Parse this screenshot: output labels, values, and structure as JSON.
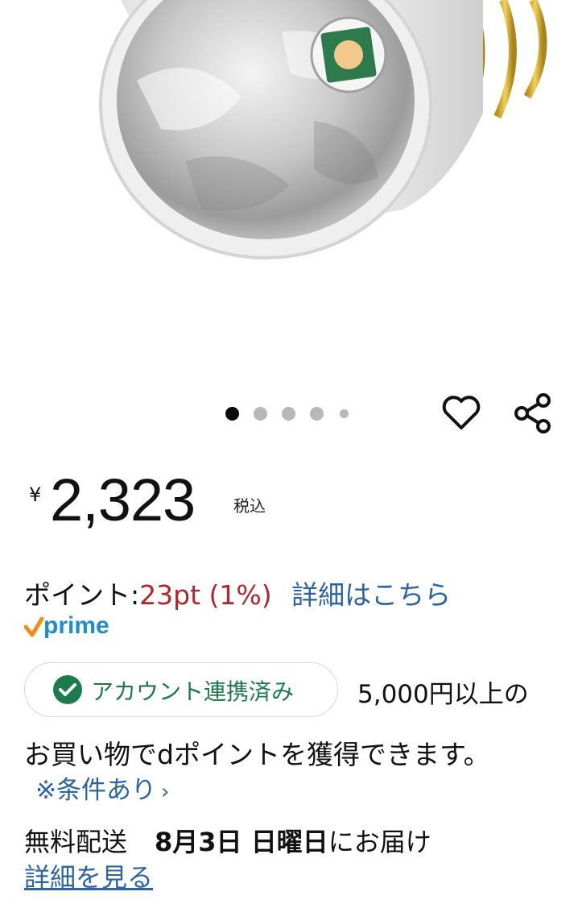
{
  "carousel": {
    "image_count": 5,
    "active_index": 0
  },
  "actions": {
    "favorite_icon": "heart-outline-icon",
    "share_icon": "share-icon"
  },
  "price": {
    "currency_symbol": "¥",
    "amount": "2,323",
    "tax_note": "税込"
  },
  "points": {
    "label": "ポイント:",
    "amount": "23pt",
    "rate": "(1%)",
    "details_link": "詳細はこちら"
  },
  "prime": {
    "label": "prime",
    "color": "#1f8dc9",
    "check_color": "#f08c1a"
  },
  "dpoint": {
    "badge_label": "アカウント連携済み",
    "badge_color": "#1c7a4c",
    "line1": "5,000円以上の",
    "line2": "お買い物でdポイントを獲得できます。",
    "conditions_link": "※条件あり",
    "conditions_chevron": "›"
  },
  "delivery": {
    "free_shipping": "無料配送",
    "date": "8月3日 日曜日",
    "suffix": "にお届け",
    "details_link": "詳細を見る"
  },
  "colors": {
    "link": "#2b64a3",
    "points": "#b1252c"
  }
}
